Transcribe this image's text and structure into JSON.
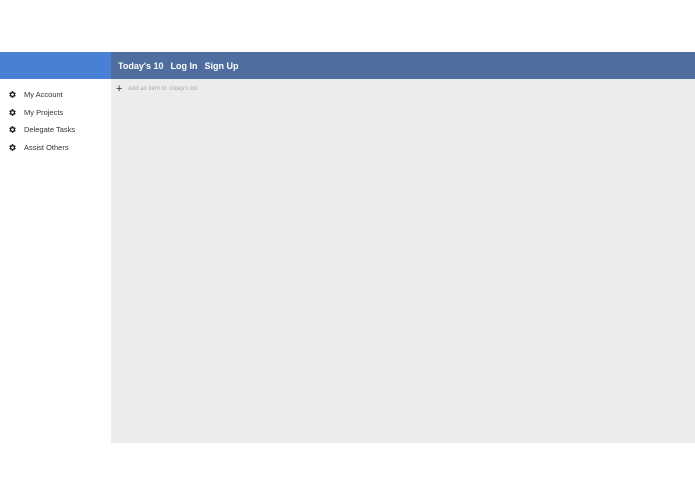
{
  "topnav": {
    "items": [
      {
        "label": "Today's 10"
      },
      {
        "label": "Log In"
      },
      {
        "label": "Sign Up"
      }
    ]
  },
  "sidebar": {
    "items": [
      {
        "label": "My Account",
        "icon": "gear-icon"
      },
      {
        "label": "My Projects",
        "icon": "gear-icon"
      },
      {
        "label": "Delegate Tasks",
        "icon": "gear-icon"
      },
      {
        "label": "Assist Others",
        "icon": "gear-icon"
      }
    ]
  },
  "main": {
    "add_item": {
      "icon": "plus-icon",
      "placeholder": "Add an item to Today's list"
    }
  },
  "colors": {
    "brand": "#4a7fd6",
    "nav": "#4f6e9f",
    "main_bg": "#ececec"
  }
}
